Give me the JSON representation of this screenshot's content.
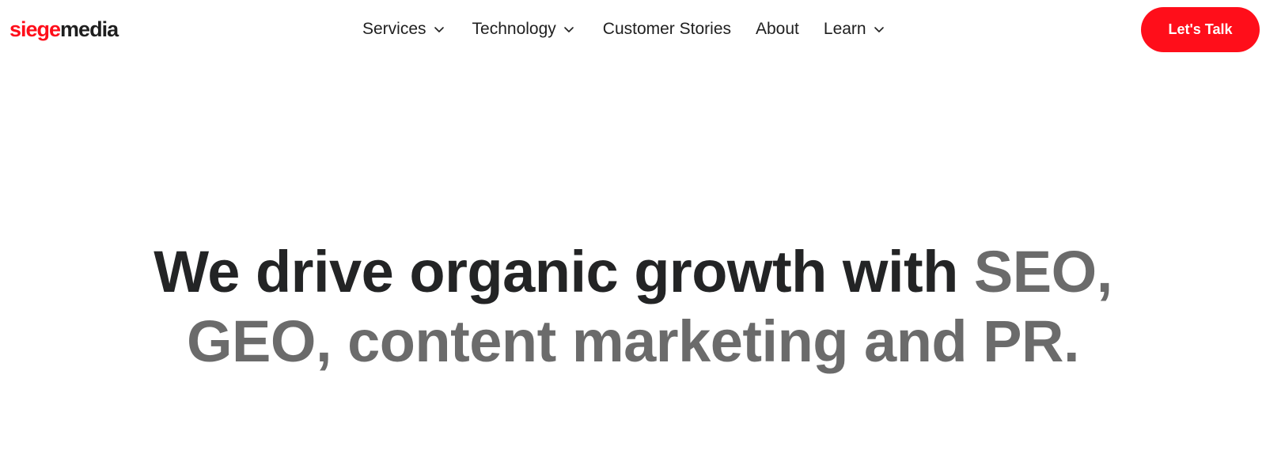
{
  "logo": {
    "part1": "siege",
    "part2": "media"
  },
  "nav": {
    "items": [
      {
        "label": "Services",
        "has_dropdown": true
      },
      {
        "label": "Technology",
        "has_dropdown": true
      },
      {
        "label": "Customer Stories",
        "has_dropdown": false
      },
      {
        "label": "About",
        "has_dropdown": false
      },
      {
        "label": "Learn",
        "has_dropdown": true
      }
    ],
    "chevron_icon": "chevron-down-icon"
  },
  "cta": {
    "label": "Let's Talk"
  },
  "hero": {
    "line1_dark": "We drive organic growth with ",
    "line1_grey": "SEO,",
    "line2_grey": "GEO, content marketing and PR."
  },
  "colors": {
    "brand_red": "#ff0e1a",
    "text_dark": "#232425",
    "text_grey": "#6b6b6b",
    "background": "#ffffff"
  }
}
